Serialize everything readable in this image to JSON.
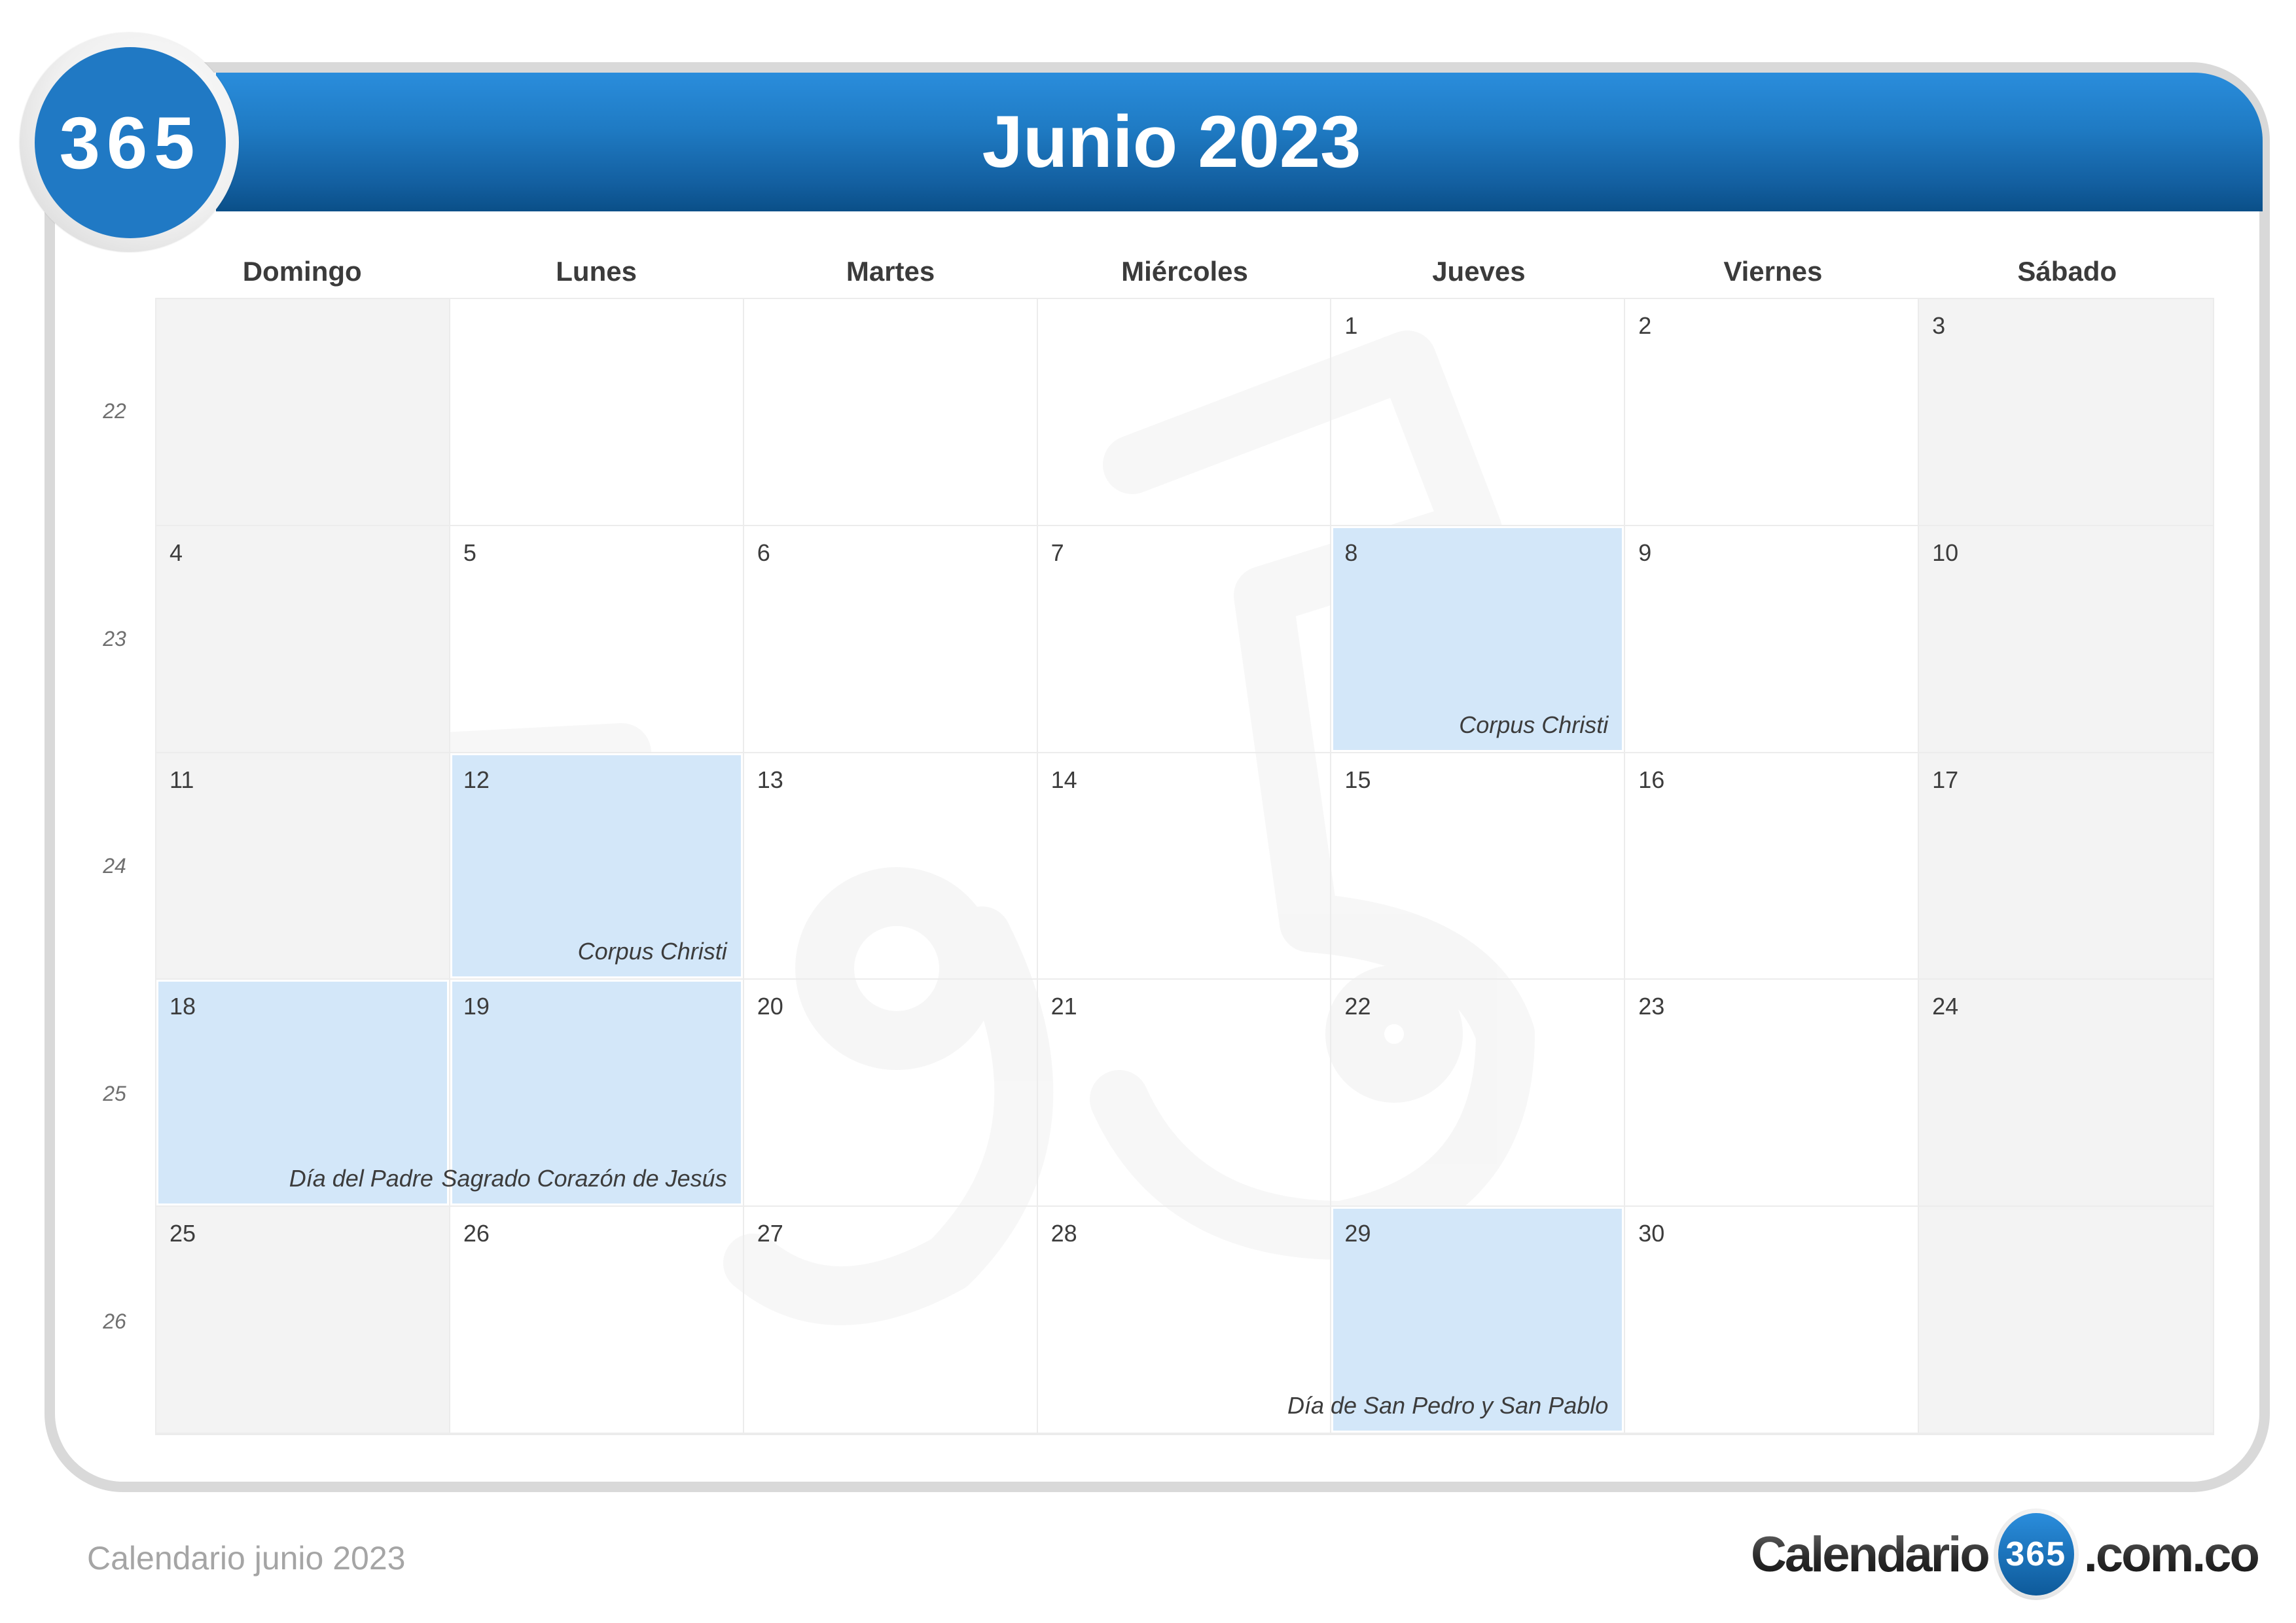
{
  "header": {
    "logo_text": "365",
    "title": "Junio 2023"
  },
  "colors": {
    "header_blue_top": "#2a8ddc",
    "header_blue_bottom": "#0a4f88",
    "holiday_bg": "#d3e7f9",
    "weekend_bg": "#f2f2f2"
  },
  "weekdays": [
    "Domingo",
    "Lunes",
    "Martes",
    "Miércoles",
    "Jueves",
    "Viernes",
    "Sábado"
  ],
  "week_numbers": [
    "22",
    "23",
    "24",
    "25",
    "26"
  ],
  "cells": [
    {
      "day": "",
      "holiday": ""
    },
    {
      "day": "",
      "holiday": ""
    },
    {
      "day": "",
      "holiday": ""
    },
    {
      "day": "",
      "holiday": ""
    },
    {
      "day": "1",
      "holiday": ""
    },
    {
      "day": "2",
      "holiday": ""
    },
    {
      "day": "3",
      "holiday": ""
    },
    {
      "day": "4",
      "holiday": ""
    },
    {
      "day": "5",
      "holiday": ""
    },
    {
      "day": "6",
      "holiday": ""
    },
    {
      "day": "7",
      "holiday": ""
    },
    {
      "day": "8",
      "holiday": "Corpus Christi"
    },
    {
      "day": "9",
      "holiday": ""
    },
    {
      "day": "10",
      "holiday": ""
    },
    {
      "day": "11",
      "holiday": ""
    },
    {
      "day": "12",
      "holiday": "Corpus Christi"
    },
    {
      "day": "13",
      "holiday": ""
    },
    {
      "day": "14",
      "holiday": ""
    },
    {
      "day": "15",
      "holiday": ""
    },
    {
      "day": "16",
      "holiday": ""
    },
    {
      "day": "17",
      "holiday": ""
    },
    {
      "day": "18",
      "holiday": "Día del Padre"
    },
    {
      "day": "19",
      "holiday": "Sagrado Corazón de Jesús"
    },
    {
      "day": "20",
      "holiday": ""
    },
    {
      "day": "21",
      "holiday": ""
    },
    {
      "day": "22",
      "holiday": ""
    },
    {
      "day": "23",
      "holiday": ""
    },
    {
      "day": "24",
      "holiday": ""
    },
    {
      "day": "25",
      "holiday": ""
    },
    {
      "day": "26",
      "holiday": ""
    },
    {
      "day": "27",
      "holiday": ""
    },
    {
      "day": "28",
      "holiday": ""
    },
    {
      "day": "29",
      "holiday": "Día de San Pedro y San Pablo"
    },
    {
      "day": "30",
      "holiday": ""
    },
    {
      "day": "",
      "holiday": ""
    }
  ],
  "footer": {
    "caption": "Calendario junio 2023",
    "brand_left": "Calendario",
    "brand_badge": "365",
    "brand_right": ".com.co"
  }
}
